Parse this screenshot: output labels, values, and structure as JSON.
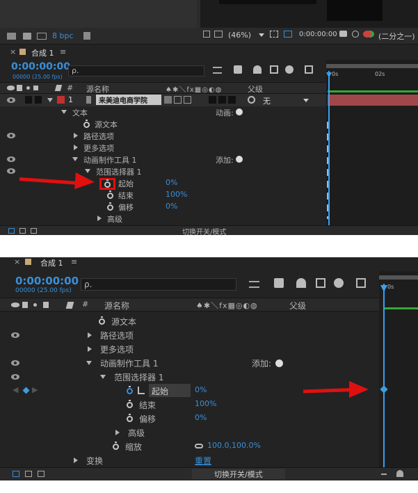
{
  "top_strip": {
    "bpc_label": "8 bpc",
    "zoom": "(46%)",
    "timecode": "0:00:00:00",
    "resolution": "(二分之一)"
  },
  "panel1": {
    "comp_tab": "合成 1",
    "timecode": "0:00:00:00",
    "fps": "00000 (25.00 fps)",
    "search_placeholder": "ρ.",
    "col_source": "源名称",
    "col_parent": "父级",
    "col_hash": "#",
    "ruler": [
      "0s",
      "02s"
    ],
    "layer_num": "1",
    "layer_name": "来美迪电商学院",
    "parent_value": "无",
    "rows": {
      "text": "文本",
      "text_anim": "动画:",
      "source_text": "源文本",
      "path": "路径选项",
      "more": "更多选项",
      "animator": "动画制作工具 1",
      "add": "添加:",
      "range": "范围选择器 1",
      "start": "起始",
      "start_val": "0%",
      "end": "结束",
      "end_val": "100%",
      "offset": "偏移",
      "offset_val": "0%",
      "advanced": "高级"
    },
    "footer": "切换开关/模式"
  },
  "panel2": {
    "comp_tab": "合成 1",
    "timecode": "0:00:00:00",
    "fps": "00000 (25.00 fps)",
    "search_placeholder": "ρ.",
    "col_hash": "#",
    "col_source": "源名称",
    "col_parent": "父级",
    "ruler": [
      "0s"
    ],
    "rows": {
      "source_text": "源文本",
      "path": "路径选项",
      "more": "更多选项",
      "animator": "动画制作工具 1",
      "add": "添加:",
      "range": "范围选择器 1",
      "start": "起始",
      "start_val": "0%",
      "end": "结束",
      "end_val": "100%",
      "offset": "偏移",
      "offset_val": "0%",
      "advanced": "高级",
      "scale": "缩放",
      "scale_val": "100.0,100.0%",
      "transform": "变换",
      "reset": "重置"
    },
    "footer": "切换开关/模式"
  },
  "colors": {
    "accent_blue": "#3a8fd8",
    "arrow_red": "#e01010",
    "layer_bar": "#a0474c",
    "playhead": "#3aa0f0",
    "work_area": "#33aa33"
  }
}
